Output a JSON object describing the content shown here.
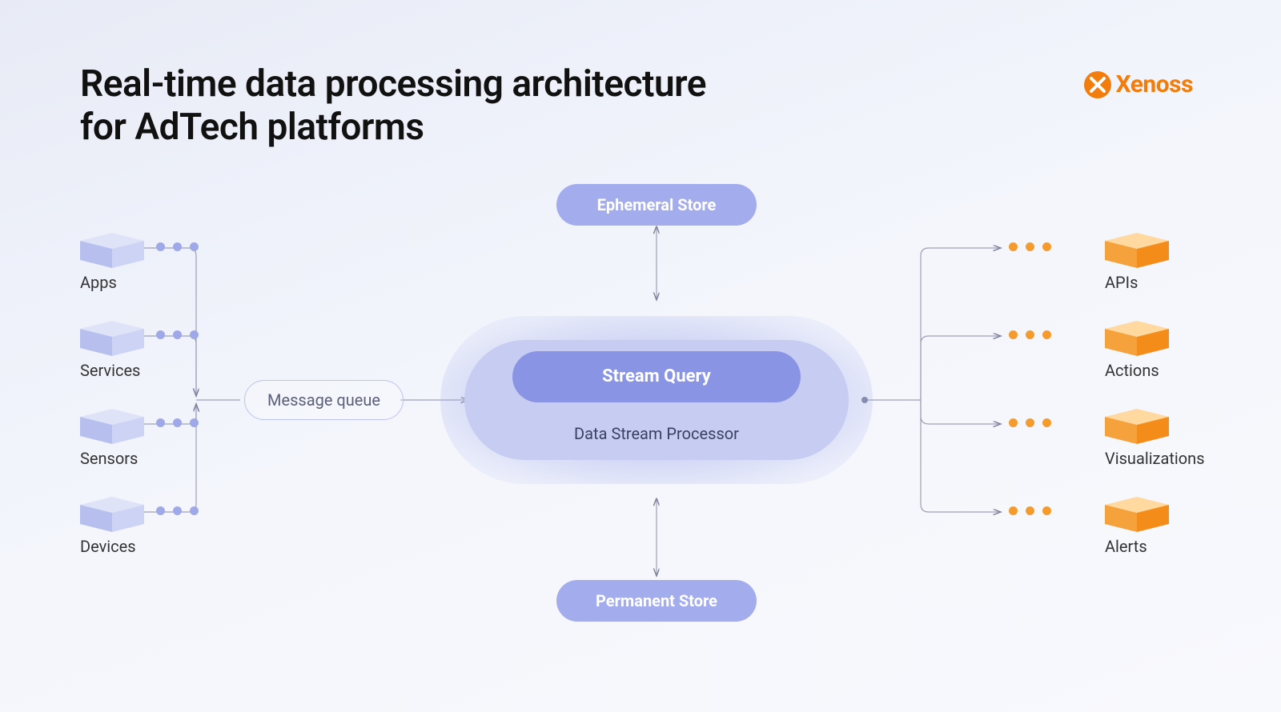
{
  "title_line1": "Real-time data processing architecture",
  "title_line2": "for AdTech platforms",
  "brand": "Xenoss",
  "sources": [
    {
      "label": "Apps"
    },
    {
      "label": "Services"
    },
    {
      "label": "Sensors"
    },
    {
      "label": "Devices"
    }
  ],
  "sinks": [
    {
      "label": "APIs"
    },
    {
      "label": "Actions"
    },
    {
      "label": "Visualizations"
    },
    {
      "label": "Alerts"
    }
  ],
  "center": {
    "message_queue": "Message queue",
    "stream_query": "Stream Query",
    "processor": "Data Stream Processor",
    "top_store": "Ephemeral Store",
    "bottom_store": "Permanent Store"
  },
  "colors": {
    "accent_blue": "#8a94e4",
    "accent_orange": "#f27d0c"
  }
}
